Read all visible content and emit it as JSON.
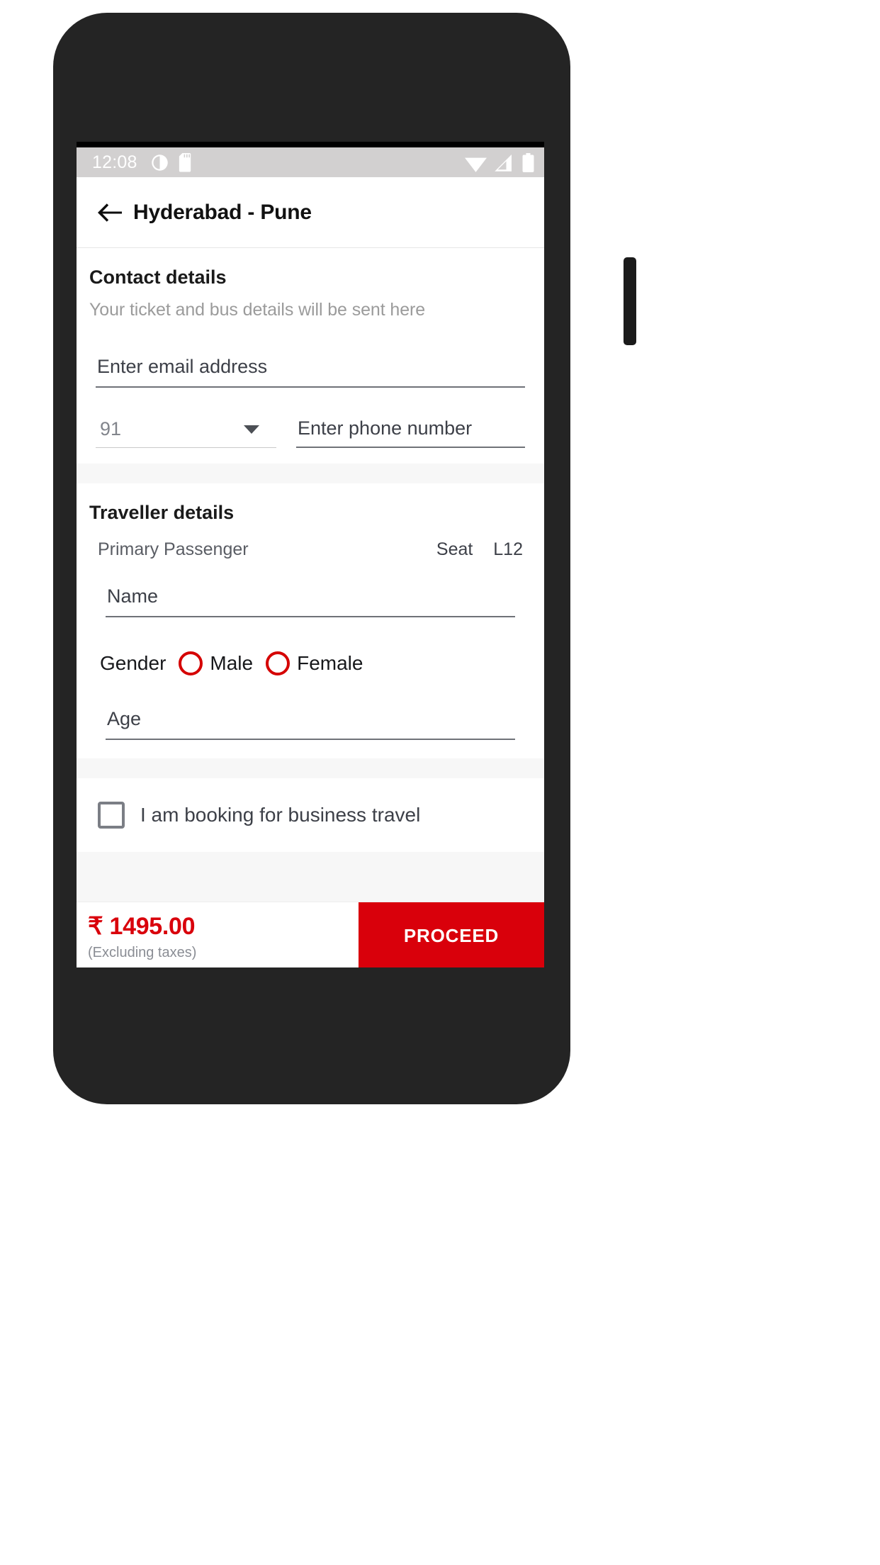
{
  "status_bar": {
    "time": "12:08",
    "left_icons": [
      "alarm-icon",
      "sd-card-icon"
    ],
    "right_icons": [
      "wifi-icon",
      "signal-icon",
      "battery-icon"
    ]
  },
  "app_bar": {
    "back_icon": "back-arrow-icon",
    "title": "Hyderabad - Pune"
  },
  "contact": {
    "title": "Contact details",
    "subtitle": "Your ticket and bus details will be sent here",
    "email_placeholder": "Enter email address",
    "country_code": "91",
    "phone_placeholder": "Enter phone number"
  },
  "traveller": {
    "title": "Traveller details",
    "passenger_label": "Primary Passenger",
    "seat_label": "Seat",
    "seat_number": "L12",
    "name_placeholder": "Name",
    "gender_label": "Gender",
    "gender_options": [
      "Male",
      "Female"
    ],
    "age_placeholder": "Age"
  },
  "business": {
    "checkbox_label": "I am booking for business travel",
    "checked": false
  },
  "bottom": {
    "price": "₹ 1495.00",
    "price_note": "(Excluding taxes)",
    "proceed_label": "PROCEED"
  },
  "nav_bar": {
    "back": "nav-back-icon",
    "home": "nav-home-icon",
    "recents": "nav-recents-icon"
  },
  "colors": {
    "accent_red": "#d9000b",
    "radio_red": "#d50000",
    "status_bar_bg": "#d2d0d0",
    "page_bg": "#f7f7f7"
  }
}
